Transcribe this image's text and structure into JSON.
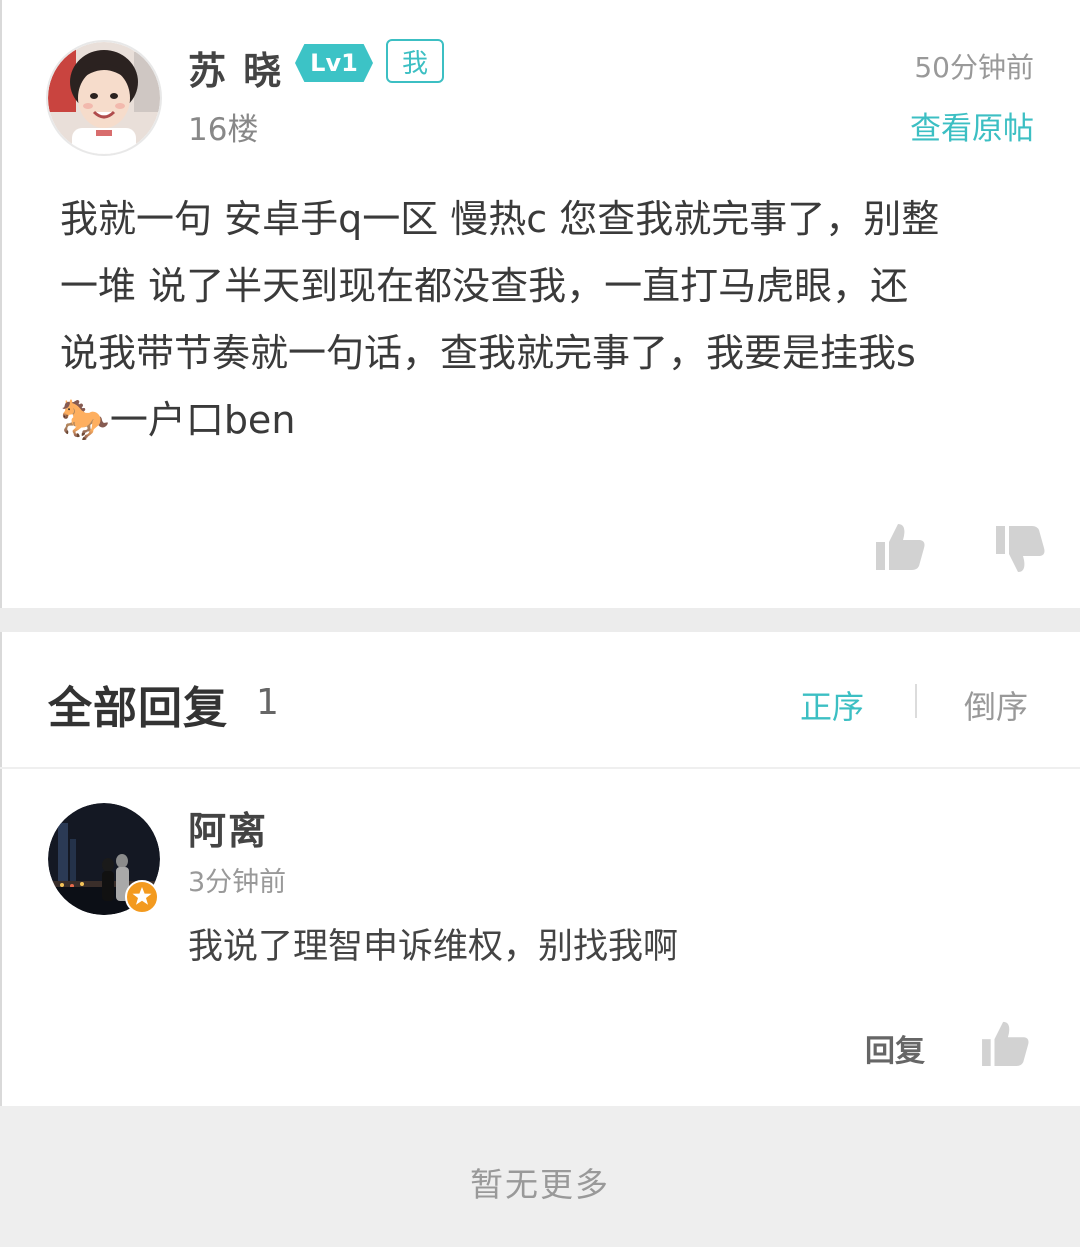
{
  "post": {
    "author": "苏 晓",
    "level": "Lv1",
    "me_tag": "我",
    "floor": "16楼",
    "time": "50分钟前",
    "view_original": "查看原帖",
    "content_line1": "我就一句 安卓手q一区 慢热c 您查我就完事了，别整",
    "content_line2": "一堆 说了半天到现在都没查我，一直打马虎眼，还",
    "content_line3": "说我带节奏就一句话，查我就完事了，我要是挂我s",
    "content_line4_emoji": "🐎",
    "content_line4_text": "一户口ben"
  },
  "replies": {
    "title": "全部回复",
    "count": "1",
    "sort_asc": "正序",
    "sort_desc": "倒序",
    "items": [
      {
        "author": "阿离",
        "time": "3分钟前",
        "text": "我说了理智申诉维权，别找我啊",
        "reply_label": "回复"
      }
    ]
  },
  "footer": {
    "no_more": "暂无更多"
  },
  "colors": {
    "accent": "#3cbfc3",
    "badge": "#3cc3c6",
    "star_badge": "#f39a1f"
  },
  "icons": [
    "thumbs-up-icon",
    "thumbs-down-icon",
    "star-badge-icon"
  ]
}
